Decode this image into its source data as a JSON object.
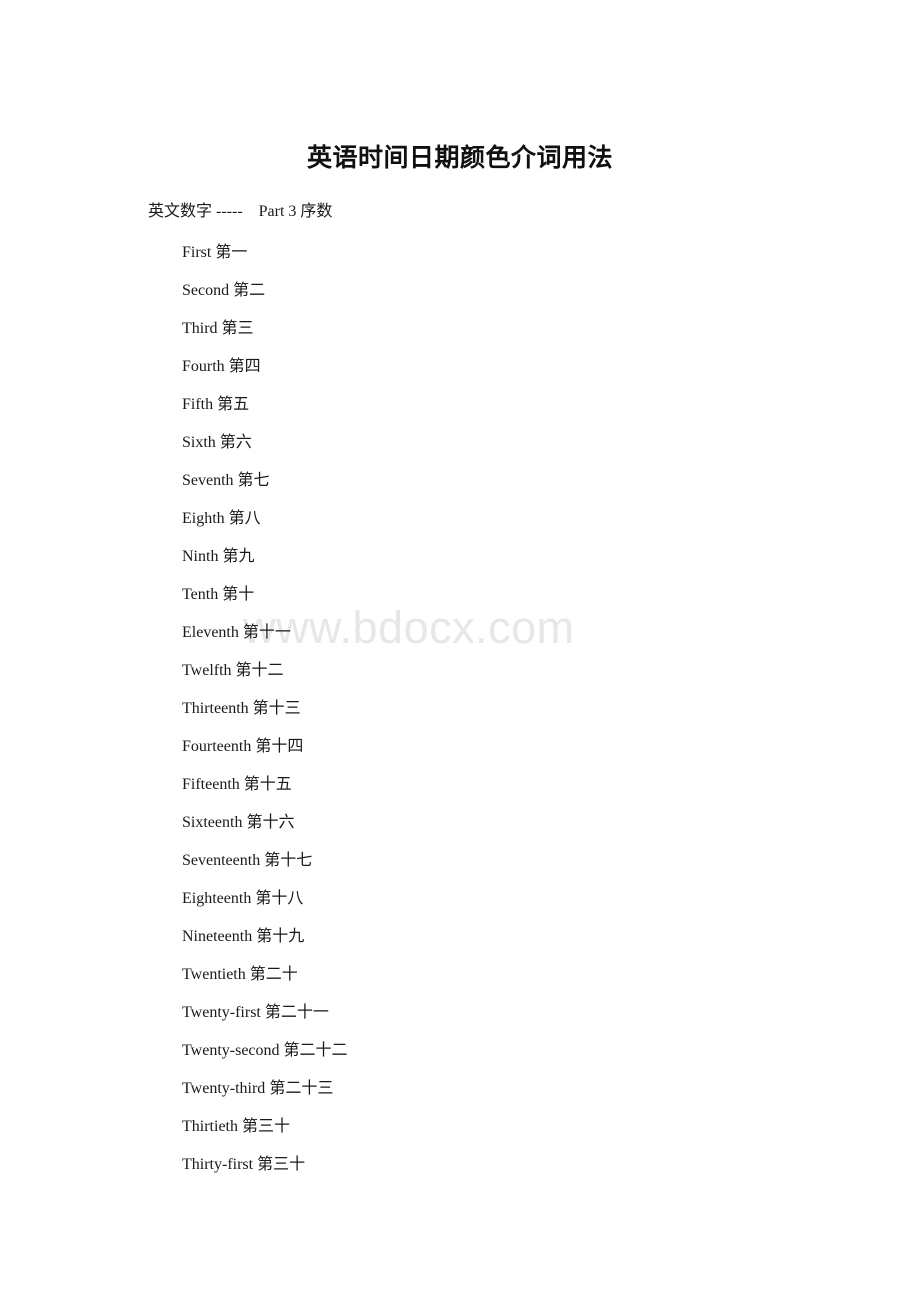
{
  "document": {
    "title": "英语时间日期颜色介词用法",
    "subtitle": "英文数字 -----    Part 3 序数",
    "watermark": "www.bdocx.com",
    "watermark_color": "#e7e7e7",
    "text_color": "#1a1a1a",
    "background_color": "#ffffff"
  },
  "ordinals": [
    {
      "english": "First",
      "chinese": "第一"
    },
    {
      "english": "Second",
      "chinese": "第二"
    },
    {
      "english": "Third",
      "chinese": "第三"
    },
    {
      "english": "Fourth",
      "chinese": "第四"
    },
    {
      "english": "Fifth",
      "chinese": "第五"
    },
    {
      "english": "Sixth",
      "chinese": "第六"
    },
    {
      "english": "Seventh",
      "chinese": "第七"
    },
    {
      "english": "Eighth",
      "chinese": "第八"
    },
    {
      "english": "Ninth",
      "chinese": "第九"
    },
    {
      "english": "Tenth",
      "chinese": "第十"
    },
    {
      "english": "Eleventh",
      "chinese": "第十一"
    },
    {
      "english": "Twelfth",
      "chinese": "第十二"
    },
    {
      "english": "Thirteenth",
      "chinese": "第十三"
    },
    {
      "english": "Fourteenth",
      "chinese": "第十四"
    },
    {
      "english": "Fifteenth",
      "chinese": "第十五"
    },
    {
      "english": "Sixteenth",
      "chinese": "第十六"
    },
    {
      "english": "Seventeenth",
      "chinese": "第十七"
    },
    {
      "english": "Eighteenth",
      "chinese": "第十八"
    },
    {
      "english": "Nineteenth",
      "chinese": "第十九"
    },
    {
      "english": "Twentieth",
      "chinese": "第二十"
    },
    {
      "english": "Twenty-first",
      "chinese": "第二十一"
    },
    {
      "english": "Twenty-second",
      "chinese": "第二十二"
    },
    {
      "english": "Twenty-third",
      "chinese": "第二十三"
    },
    {
      "english": "Thirtieth",
      "chinese": "第三十"
    },
    {
      "english": "Thirty-first",
      "chinese": "第三十"
    }
  ]
}
